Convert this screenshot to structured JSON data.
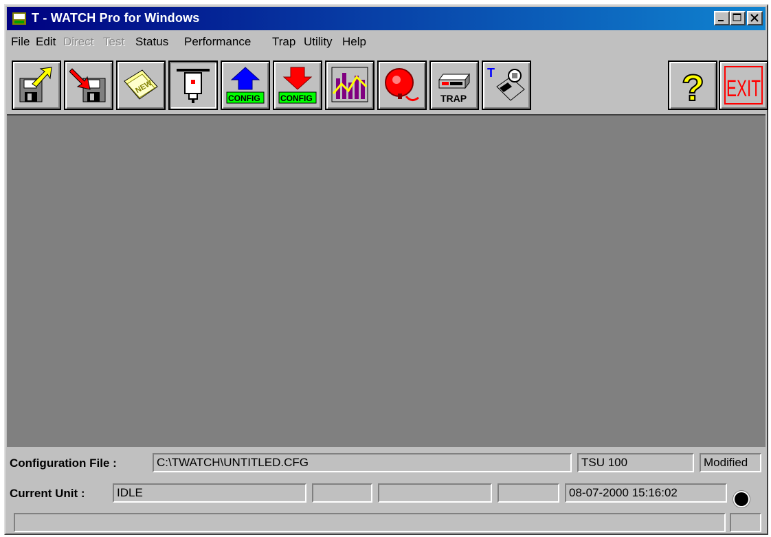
{
  "window": {
    "title": "T - WATCH Pro for Windows",
    "controls": [
      "minimize",
      "maximize",
      "close"
    ]
  },
  "menu": [
    {
      "label": "File",
      "enabled": true
    },
    {
      "label": "Edit",
      "enabled": true
    },
    {
      "label": "Direct",
      "enabled": false
    },
    {
      "label": "Test",
      "enabled": false
    },
    {
      "label": "Status",
      "enabled": true
    },
    {
      "label": "Performance",
      "enabled": true
    },
    {
      "label": "Trap",
      "enabled": true
    },
    {
      "label": "Utility",
      "enabled": true
    },
    {
      "label": "Help",
      "enabled": true
    }
  ],
  "toolbar": {
    "buttons": [
      {
        "name": "save-file",
        "icon": "floppy-export-icon"
      },
      {
        "name": "load-file",
        "icon": "floppy-import-icon"
      },
      {
        "name": "new-file",
        "icon": "new-folder-icon",
        "text": "NEW"
      },
      {
        "name": "connect",
        "icon": "connector-plug-icon"
      },
      {
        "name": "upload-config",
        "icon": "upload-config-icon",
        "text": "CONFIG"
      },
      {
        "name": "download-config",
        "icon": "download-config-icon",
        "text": "CONFIG"
      },
      {
        "name": "performance",
        "icon": "bar-chart-icon"
      },
      {
        "name": "alarm",
        "icon": "alarm-bell-icon"
      },
      {
        "name": "trap",
        "icon": "trap-device-icon",
        "text": "TRAP"
      },
      {
        "name": "terminal",
        "icon": "telephone-icon",
        "text": "T"
      },
      {
        "name": "help",
        "icon": "question-mark-icon",
        "text": "?"
      },
      {
        "name": "exit",
        "icon": "exit-sign-icon",
        "text": "EXIT"
      }
    ]
  },
  "status": {
    "config_label": "Configuration File :",
    "config_file": "C:\\TWATCH\\UNTITLED.CFG",
    "unit_type": "TSU 100",
    "modified": "Modified",
    "unit_label": "Current Unit :",
    "current_unit": "IDLE",
    "datetime": "08-07-2000  15:16:02",
    "message": ""
  },
  "colors": {
    "face": "#c0c0c0",
    "workspace": "#808080",
    "title_start": "#000080",
    "title_end": "#1084d0",
    "config_green": "#00ff00",
    "exit_red": "#ff0000"
  }
}
